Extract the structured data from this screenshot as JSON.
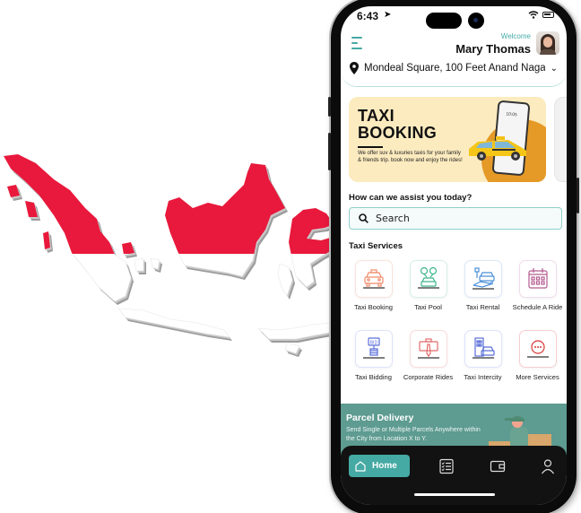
{
  "status_bar": {
    "time": "6:43"
  },
  "header": {
    "welcome": "Welcome",
    "user_name": "Mary Thomas",
    "location": "Mondeal Square, 100 Feet Anand Naga..."
  },
  "banner": {
    "title_line1": "TAXI",
    "title_line2": "BOOKING",
    "description": "We offer suv & luxuries taxis for your family & friends trip. book now and enjoy the rides!",
    "phone_time": "10:05"
  },
  "assist": {
    "heading": "How can we assist you today?",
    "search_placeholder": "Search"
  },
  "services": {
    "heading": "Taxi Services",
    "items": [
      {
        "label": "Taxi Booking",
        "icon": "taxi-car-icon",
        "color": "#f08a6a"
      },
      {
        "label": "Taxi Pool",
        "icon": "car-pool-icon",
        "color": "#3fb58e"
      },
      {
        "label": "Taxi Rental",
        "icon": "car-rental-icon",
        "color": "#4a8fd8"
      },
      {
        "label": "Schedule A Ride",
        "icon": "calendar-icon",
        "color": "#b55a8f"
      },
      {
        "label": "Taxi Bidding",
        "icon": "bid-icon",
        "color": "#5a6fd8"
      },
      {
        "label": "Corporate Rides",
        "icon": "corporate-icon",
        "color": "#e46a6a"
      },
      {
        "label": "Taxi Intercity",
        "icon": "intercity-icon",
        "color": "#5a6fd8"
      },
      {
        "label": "More Services",
        "icon": "more-icon",
        "color": "#d83a3a"
      }
    ]
  },
  "parcel": {
    "title": "Parcel Delivery",
    "description": "Send Single or Multiple Parcels Anywhere within the City from Location X to Y."
  },
  "tab_bar": {
    "home_label": "Home",
    "tabs": [
      "home-icon",
      "orders-list-icon",
      "wallet-icon",
      "profile-icon"
    ]
  },
  "colors": {
    "accent": "#45aaa4",
    "flag_red": "#e8193c",
    "parcel_bg": "#5e9b91",
    "banner_bg": "#fcebbf"
  }
}
